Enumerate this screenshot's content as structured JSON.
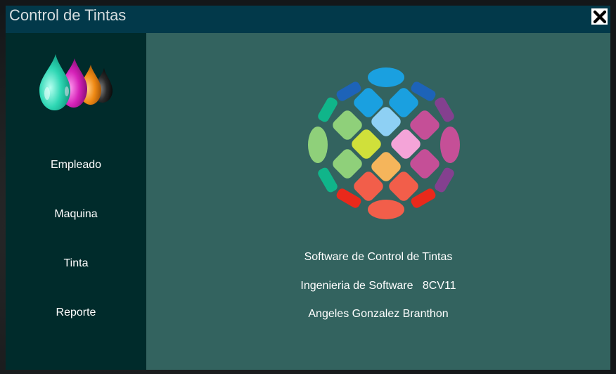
{
  "window": {
    "title": "Control de Tintas"
  },
  "title_bar": {
    "close_icon": "close-icon"
  },
  "sidebar": {
    "logo_icon": "ink-drops-logo",
    "items": [
      {
        "label": "Empleado"
      },
      {
        "label": "Maquina"
      },
      {
        "label": "Tinta"
      },
      {
        "label": "Reporte"
      }
    ]
  },
  "main": {
    "emblem_icon": "colorful-sphere-logo",
    "lines": [
      {
        "text": "Software de Control de Tintas"
      },
      {
        "text": "Ingenieria de Software   8CV11"
      },
      {
        "text": "Angeles Gonzalez Branthon"
      }
    ]
  },
  "colors": {
    "titlebar": "#02394a",
    "sidebar": "#002b2b",
    "main": "#33635f",
    "text": "#ffffff"
  }
}
